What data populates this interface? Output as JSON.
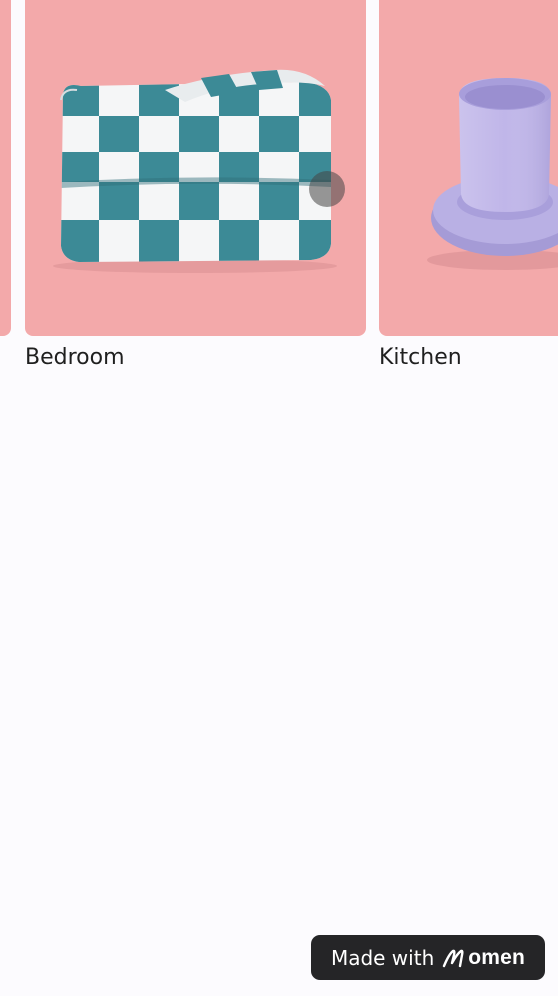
{
  "categories": [
    {
      "label": "",
      "image": "category-image"
    },
    {
      "label": "Bedroom",
      "image": "checkered-blanket"
    },
    {
      "label": "Kitchen",
      "image": "lavender-cup-and-saucer"
    }
  ],
  "badge": {
    "prefix": "Made with",
    "brand": "omen",
    "brand_mark": "M"
  },
  "colors": {
    "card_bg": "#f3a9aa",
    "page_bg": "#fcfbfe",
    "blanket_teal": "#3c8a96",
    "cup_lavender": "#b6addf",
    "badge_bg": "#252527"
  }
}
